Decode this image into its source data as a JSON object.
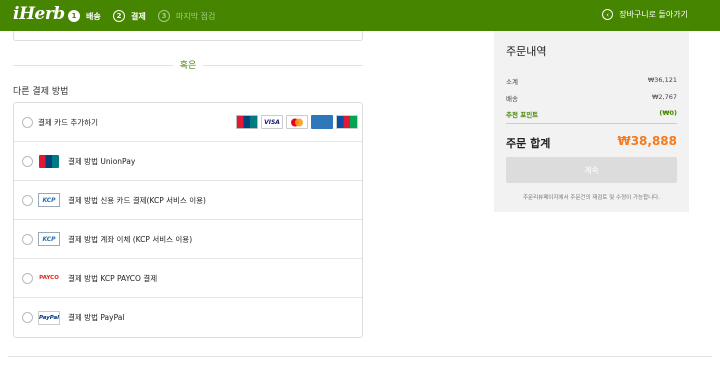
{
  "header": {
    "logo": "iHerb",
    "steps": [
      {
        "num": "1",
        "label": "배송"
      },
      {
        "num": "2",
        "label": "결제"
      },
      {
        "num": "3",
        "label": "마지막 점검"
      }
    ],
    "back_link": "장바구니로 돌아가기",
    "brand_color": "#458500"
  },
  "payment": {
    "or_text": "혹은",
    "section_title": "다른 결제 방법",
    "methods": [
      {
        "label": "결제 카드 추가하기",
        "icon": "credit-cards"
      },
      {
        "label": "결제 방법 UnionPay",
        "icon": "unionpay-logo"
      },
      {
        "label": "결제 방법 신용 카드 결제(KCP 서비스 이용)",
        "icon": "kcp-logo"
      },
      {
        "label": "결제 방법 계좌 이체 (KCP 서비스 이용)",
        "icon": "kcp-logo"
      },
      {
        "label": "결제 방법 KCP PAYCO 결제",
        "icon": "payco-logo"
      },
      {
        "label": "결제 방법 PayPal",
        "icon": "paypal-logo"
      }
    ],
    "card_brands": [
      "UnionPay",
      "VISA",
      "Mastercard",
      "AMEX",
      "JCB"
    ],
    "logo_text": {
      "visa": "VISA",
      "kcp": "KCP",
      "payco": "PAYCO",
      "paypal": "PayPal"
    }
  },
  "summary": {
    "title": "주문내역",
    "rows": [
      {
        "label": "소계",
        "value": "₩36,121"
      },
      {
        "label": "배송",
        "value": "₩2,767"
      },
      {
        "label": "추천 포인트",
        "value": "(₩0)"
      }
    ],
    "total_label": "주문 합계",
    "total_value": "₩38,888",
    "button_label": "계속",
    "note": "주문리뷰페이지에서 주문건의 재검토 및 수정이 가능합니다.",
    "accent_color": "#f47b20"
  }
}
